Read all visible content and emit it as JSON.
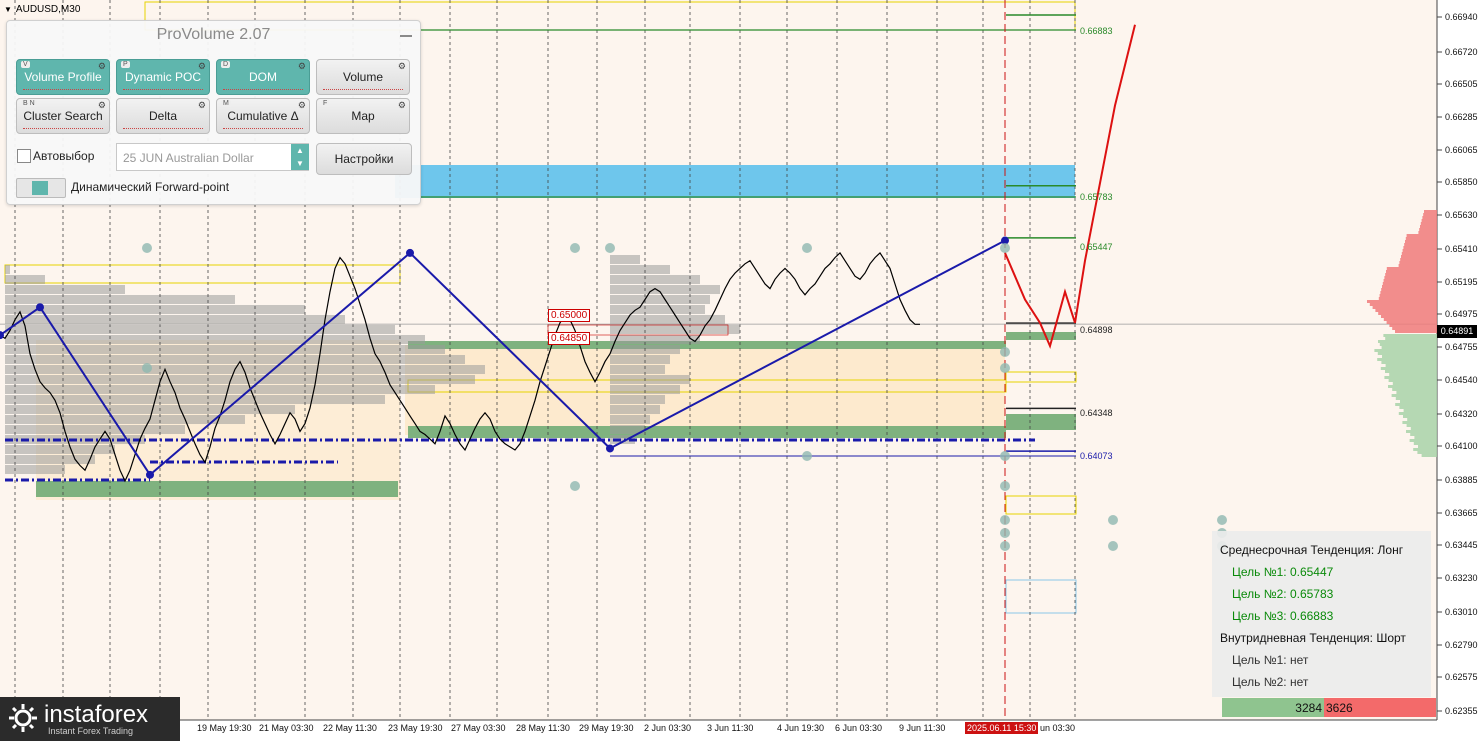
{
  "symbol_label": "AUDUSD,M30",
  "panel": {
    "title": "ProVolume 2.07",
    "buttons_row1": [
      {
        "label": "Volume Profile",
        "key": "V",
        "active": true
      },
      {
        "label": "Dynamic POC",
        "key": "P",
        "active": true
      },
      {
        "label": "DOM",
        "key": "D",
        "active": true
      },
      {
        "label": "Volume",
        "key": "",
        "active": false
      }
    ],
    "buttons_row2": [
      {
        "label": "Cluster Search",
        "key": "B N",
        "active": false
      },
      {
        "label": "Delta",
        "key": "",
        "active": false
      },
      {
        "label": "Cumulative Δ",
        "key": "M",
        "active": false
      },
      {
        "label": "Map",
        "key": "F",
        "active": false
      }
    ],
    "autoselect_label": "Автовыбор",
    "instrument_value": "25 JUN Australian Dollar",
    "settings_label": "Настройки",
    "forward_point_label": "Динамический Forward-point"
  },
  "trend_box": {
    "medium_title": "Среднесрочная Тенденция: Лонг",
    "medium_targets": [
      "Цель №1: 0.65447",
      "Цель №2: 0.65783",
      "Цель №3: 0.66883"
    ],
    "intraday_title": "Внутридневная Тенденция: Шорт",
    "intraday_targets": [
      "Цель №1: нет",
      "Цель №2: нет"
    ],
    "buy_volume": "3284",
    "sell_volume": "3626"
  },
  "logo": {
    "name": "instaforex",
    "tagline": "Instant Forex Trading"
  },
  "colors": {
    "price": "#000000",
    "zigzag": "#1a1aaa",
    "forecast": "#dd1111",
    "green_zone": "#7fb27f",
    "blue_zone": "#6ec6ec",
    "yellow_box": "#e8d400",
    "profile": "#9a9a9a",
    "sell": "#f07a7a",
    "buy": "#a8d2a8"
  },
  "chart_data": {
    "type": "line",
    "title": "AUDUSD,M30",
    "y_axis": {
      "ticks": [
        "0.66940",
        "0.66720",
        "0.66505",
        "0.66285",
        "0.66065",
        "0.65850",
        "0.65630",
        "0.65410",
        "0.65195",
        "0.64975",
        "0.64755",
        "0.64540",
        "0.64320",
        "0.64100",
        "0.63885",
        "0.63665",
        "0.63445",
        "0.63230",
        "0.63010",
        "0.62790",
        "0.62575",
        "0.62355"
      ],
      "range": [
        0.6234,
        0.6698
      ]
    },
    "x_axis": {
      "ticks": [
        "19 May 19:30",
        "21 May 03:30",
        "22 May 11:30",
        "23 May 19:30",
        "27 May 03:30",
        "28 May 11:30",
        "29 May 19:30",
        "2 Jun 03:30",
        "3 Jun 11:30",
        "4 Jun 19:30",
        "6 Jun 03:30",
        "9 Jun 11:30",
        "2025.06.11 15:30",
        "un 03:30"
      ],
      "highlighted": "2025.06.11 15:30"
    },
    "current_price": "0.64891",
    "levels": [
      {
        "name": "target-3",
        "value": 0.66883,
        "label": "0.66883",
        "color": "#2a8a2a"
      },
      {
        "name": "target-2",
        "value": 0.65783,
        "label": "0.65783",
        "color": "#2a8a2a"
      },
      {
        "name": "target-1",
        "value": 0.65447,
        "label": "0.65447",
        "color": "#2a8a2a"
      },
      {
        "name": "pivot",
        "value": 0.64898,
        "label": "0.64898",
        "color": "#222222"
      },
      {
        "name": "support-1",
        "value": 0.64348,
        "label": "0.64348",
        "color": "#222222"
      },
      {
        "name": "support-2",
        "value": 0.64073,
        "label": "0.64073",
        "color": "#1a1aaa"
      }
    ],
    "box_labels": [
      "0.65000",
      "0.64850"
    ],
    "price_series": {
      "x": [
        0,
        5,
        10,
        15,
        20,
        25,
        30,
        35,
        40,
        45,
        50,
        55,
        60,
        65,
        70,
        75,
        80,
        85,
        90,
        95,
        100,
        105,
        110,
        115,
        120,
        125,
        130,
        135,
        140,
        145,
        150,
        155,
        160,
        165,
        170,
        175,
        180,
        185,
        190,
        195,
        200,
        205,
        210,
        215,
        220,
        225,
        230,
        235,
        240,
        245,
        250,
        255,
        260,
        265,
        270,
        275,
        280,
        285,
        290,
        295,
        300,
        305,
        310,
        315,
        320,
        325,
        330,
        335,
        340,
        345,
        350,
        355,
        360,
        365,
        370,
        375,
        380,
        385,
        390,
        395,
        400,
        405,
        410,
        415,
        420,
        425,
        430,
        435,
        440,
        445,
        450,
        455,
        460,
        465,
        470,
        475,
        480,
        485,
        490,
        495,
        500,
        505,
        510,
        515,
        520,
        525,
        530,
        535,
        540,
        545,
        550,
        555,
        560,
        565,
        570,
        575,
        580,
        585,
        590,
        595,
        600,
        605,
        610,
        615,
        620,
        625,
        630,
        635,
        640,
        645,
        650,
        655,
        660,
        665,
        670,
        675,
        680,
        685,
        690,
        695,
        700,
        705,
        710,
        715,
        720,
        725,
        730,
        735,
        740,
        745,
        750,
        755,
        760,
        765,
        770,
        775,
        780,
        785,
        790,
        795,
        800,
        805,
        810,
        815,
        820,
        825,
        830,
        835,
        840,
        845,
        850,
        855,
        860,
        865,
        870,
        875,
        880,
        885,
        890,
        895,
        900,
        905,
        910,
        915,
        920,
        925,
        930,
        935,
        940,
        945,
        950,
        955,
        960,
        965,
        970,
        975,
        980,
        985,
        990,
        995,
        1000,
        1005,
        1010,
        1015,
        1020,
        1025,
        1030
      ],
      "y": [
        0.6482,
        0.648,
        0.6485,
        0.6492,
        0.6497,
        0.6488,
        0.647,
        0.646,
        0.6452,
        0.6448,
        0.6445,
        0.644,
        0.6432,
        0.642,
        0.641,
        0.6402,
        0.6398,
        0.6395,
        0.6402,
        0.641,
        0.6415,
        0.642,
        0.6415,
        0.6405,
        0.6395,
        0.6388,
        0.6395,
        0.6405,
        0.6415,
        0.6422,
        0.6428,
        0.644,
        0.6452,
        0.646,
        0.6452,
        0.6445,
        0.6435,
        0.6428,
        0.642,
        0.6412,
        0.6405,
        0.64,
        0.641,
        0.6422,
        0.643,
        0.644,
        0.6452,
        0.646,
        0.6465,
        0.6458,
        0.6448,
        0.644,
        0.6432,
        0.6425,
        0.6418,
        0.6412,
        0.6418,
        0.6425,
        0.6432,
        0.6428,
        0.642,
        0.6425,
        0.6435,
        0.645,
        0.647,
        0.6492,
        0.651,
        0.6525,
        0.6532,
        0.6528,
        0.652,
        0.6512,
        0.6502,
        0.6492,
        0.648,
        0.647,
        0.6465,
        0.6458,
        0.645,
        0.6445,
        0.644,
        0.6435,
        0.643,
        0.6425,
        0.642,
        0.6418,
        0.6415,
        0.6412,
        0.642,
        0.643,
        0.6425,
        0.6418,
        0.6412,
        0.6408,
        0.6415,
        0.6422,
        0.6428,
        0.6432,
        0.6428,
        0.642,
        0.6415,
        0.6412,
        0.641,
        0.6408,
        0.6412,
        0.642,
        0.643,
        0.644,
        0.6452,
        0.6462,
        0.6472,
        0.6482,
        0.649,
        0.6495,
        0.6492,
        0.6485,
        0.6475,
        0.6465,
        0.6458,
        0.6452,
        0.6458,
        0.6465,
        0.647,
        0.6478,
        0.6485,
        0.649,
        0.6495,
        0.6498,
        0.65,
        0.6505,
        0.651,
        0.6512,
        0.651,
        0.6505,
        0.65,
        0.6495,
        0.649,
        0.6485,
        0.648,
        0.6478,
        0.6482,
        0.6488,
        0.6492,
        0.6498,
        0.6505,
        0.6512,
        0.6518,
        0.6522,
        0.6525,
        0.6528,
        0.653,
        0.6525,
        0.652,
        0.6515,
        0.6512,
        0.6518,
        0.6522,
        0.6525,
        0.6522,
        0.6518,
        0.6512,
        0.6508,
        0.6512,
        0.6515,
        0.652,
        0.6525,
        0.6528,
        0.6532,
        0.6535,
        0.653,
        0.6525,
        0.652,
        0.6518,
        0.6522,
        0.6528,
        0.6532,
        0.6535,
        0.653,
        0.6525,
        0.6515,
        0.6505,
        0.6498,
        0.6492,
        0.6489,
        0.6489
      ]
    },
    "zigzag": {
      "x": [
        0,
        40,
        150,
        410,
        610,
        1005
      ],
      "y": [
        0.6482,
        0.65,
        0.6392,
        0.6535,
        0.6409,
        0.6543
      ]
    },
    "forecast": {
      "x": [
        1005,
        1015,
        1025,
        1040,
        1050,
        1065,
        1075,
        1085,
        1100,
        1115,
        1135
      ],
      "y": [
        0.6535,
        0.652,
        0.6505,
        0.649,
        0.6475,
        0.651,
        0.649,
        0.653,
        0.658,
        0.663,
        0.6682
      ]
    }
  }
}
